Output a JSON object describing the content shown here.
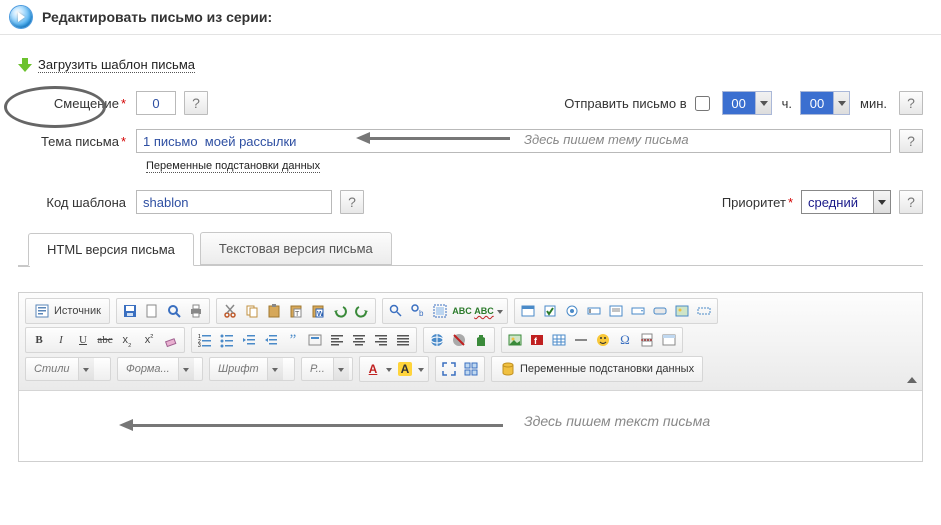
{
  "header": {
    "title": "Редактировать письмо из серии:"
  },
  "load_template_link": "Загрузить шаблон письма",
  "offset": {
    "label": "Смещение",
    "value": "0"
  },
  "send": {
    "label": "Отправить письмо в",
    "checked": false,
    "hours": "00",
    "hours_unit": "ч.",
    "minutes": "00",
    "minutes_unit": "мин."
  },
  "subject": {
    "label": "Тема письма",
    "value": "1 письмо  моей рассылки",
    "hint": "Здесь пишем тему  письма",
    "vars_link": "Переменные подстановки данных"
  },
  "template_code": {
    "label": "Код шаблона",
    "value": "shablon"
  },
  "priority": {
    "label": "Приоритет",
    "value": "средний"
  },
  "tabs": {
    "html": "HTML версия письма",
    "text": "Текстовая версия письма"
  },
  "editor": {
    "source_label": "Источник",
    "styles": "Стили",
    "format": "Форма...",
    "font": "Шрифт",
    "size": "Р...",
    "vars_button": "Переменные подстановки данных",
    "body_hint": "Здесь пишем  текст письма"
  },
  "help": "?"
}
